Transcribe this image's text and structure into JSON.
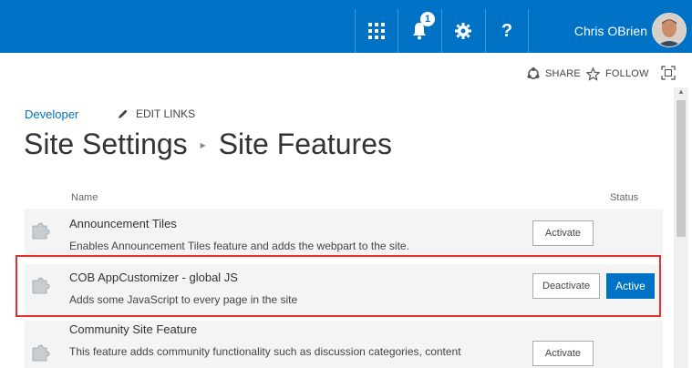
{
  "suite_bar": {
    "notification_count": "1",
    "help_label": "?",
    "user_name": "Chris OBrien"
  },
  "actions": {
    "share_label": "SHARE",
    "follow_label": "FOLLOW"
  },
  "breadcrumb": {
    "site_link": "Developer",
    "edit_links_label": "EDIT LINKS"
  },
  "title": {
    "part1": "Site Settings",
    "part2": "Site Features"
  },
  "table": {
    "col_name": "Name",
    "col_status": "Status"
  },
  "features": [
    {
      "title": "Announcement Tiles",
      "description": "Enables Announcement Tiles feature and adds the webpart to the site.",
      "button": "Activate",
      "status": ""
    },
    {
      "title": "COB AppCustomizer - global JS",
      "description": "Adds some JavaScript to every page in the site",
      "button": "Deactivate",
      "status": "Active"
    },
    {
      "title": "Community Site Feature",
      "description": "This feature adds community functionality such as discussion categories, content",
      "button": "Activate",
      "status": ""
    }
  ],
  "colors": {
    "suite_bar": "#0072c6",
    "highlight": "#e0332e",
    "active_badge": "#0072c6"
  }
}
